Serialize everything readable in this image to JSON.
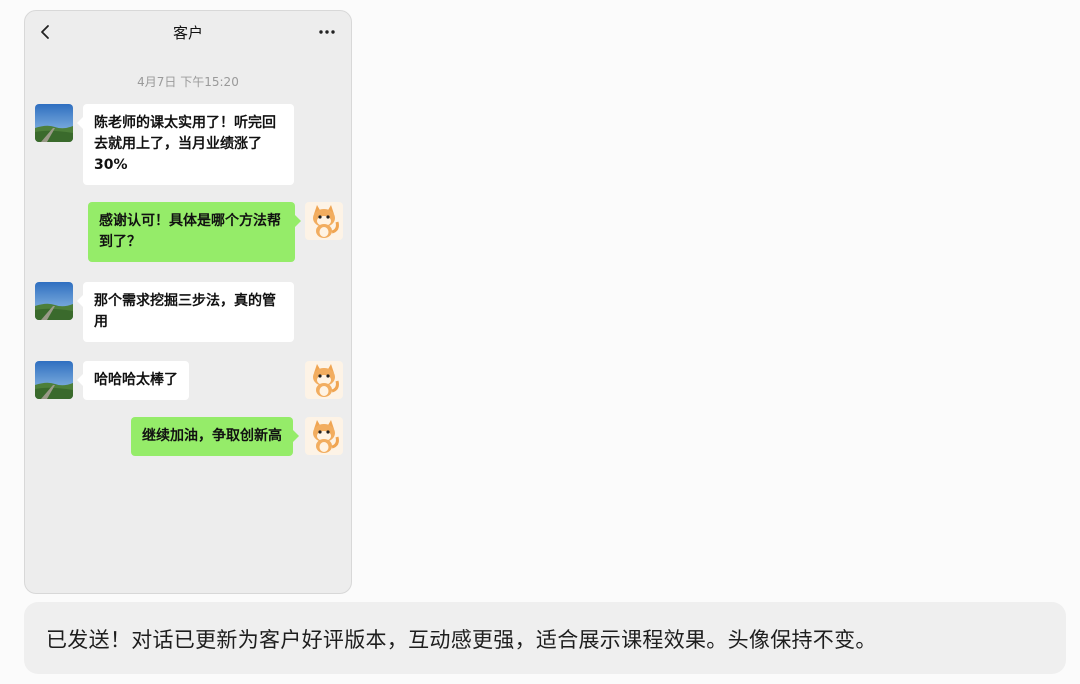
{
  "chat": {
    "title": "客户",
    "timestamp": "4月7日 下午15:20",
    "messages": [
      {
        "side": "in",
        "text": "陈老师的课太实用了！听完回去就用上了，当月业绩涨了30%"
      },
      {
        "side": "out",
        "text": "感谢认可！具体是哪个方法帮到了？"
      },
      {
        "side": "in",
        "text": "那个需求挖掘三步法，真的管用"
      },
      {
        "side": "in",
        "text": "哈哈哈太棒了"
      },
      {
        "side": "out",
        "text": "继续加油，争取创新高"
      }
    ]
  },
  "icons": {
    "back": "chevron-left-icon",
    "more": "more-dots-icon",
    "customer_avatar": "landscape-avatar",
    "self_avatar": "cat-avatar"
  },
  "colors": {
    "outgoing_bubble": "#95ec69",
    "incoming_bubble": "#ffffff",
    "chat_background": "#ededed"
  },
  "assistant_note": {
    "text": "已发送！对话已更新为客户好评版本，互动感更强，适合展示课程效果。头像保持不变。"
  }
}
